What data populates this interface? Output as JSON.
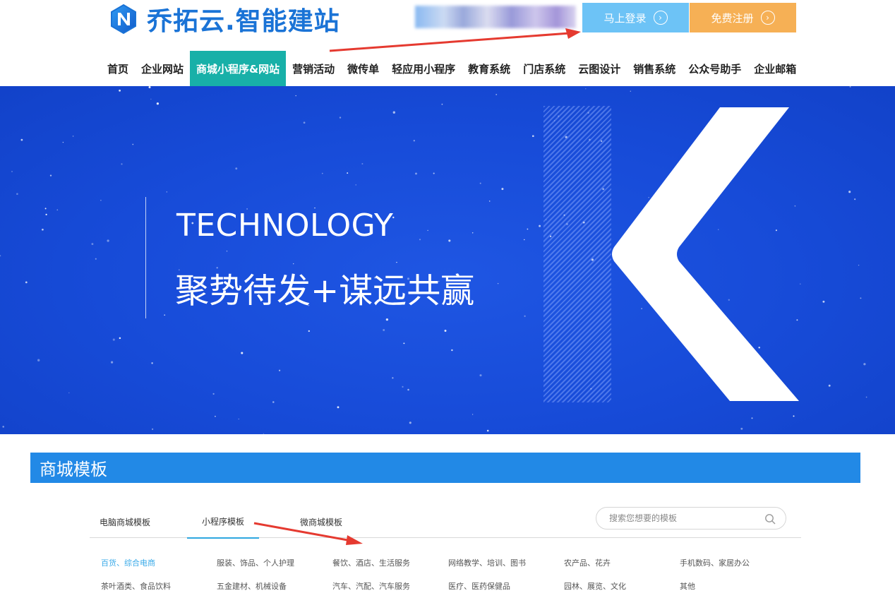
{
  "brand": {
    "logo_text": "乔拓云.智能建站",
    "logo_mark_icon": "n-logo-icon",
    "color": "#1a73d6"
  },
  "header": {
    "login_label": "马上登录",
    "register_label": "免费注册",
    "arrow_glyph": "›",
    "login_color": "#6dc3f6",
    "register_color": "#f6b055"
  },
  "nav": {
    "items": [
      {
        "label": "首页"
      },
      {
        "label": "企业网站"
      },
      {
        "label": "商城小程序&网站",
        "active": true
      },
      {
        "label": "营销活动"
      },
      {
        "label": "微传单"
      },
      {
        "label": "轻应用小程序"
      },
      {
        "label": "教育系统"
      },
      {
        "label": "门店系统"
      },
      {
        "label": "云图设计"
      },
      {
        "label": "销售系统"
      },
      {
        "label": "公众号助手"
      },
      {
        "label": "企业邮箱"
      }
    ],
    "active_color": "#18b0a8"
  },
  "banner": {
    "headline": "TECHNOLOGY",
    "slogan": "聚势待发+谋远共赢",
    "background": "#174bd8"
  },
  "section": {
    "title": "商城模板",
    "color": "#2289e6"
  },
  "tabs": {
    "items": [
      {
        "label": "电脑商城模板"
      },
      {
        "label": "小程序模板",
        "active": true
      },
      {
        "label": "微商城模板"
      }
    ],
    "search_placeholder": "搜索您想要的模板"
  },
  "categories": {
    "rows": [
      [
        "百货、综合电商",
        "服装、饰品、个人护理",
        "餐饮、酒店、生活服务",
        "网络教学、培训、图书",
        "农产品、花卉",
        "手机数码、家居办公"
      ],
      [
        "茶叶酒类、食品饮料",
        "五金建材、机械设备",
        "汽车、汽配、汽车服务",
        "医疗、医药保健品",
        "园林、展览、文化",
        "其他"
      ]
    ],
    "active_color": "#38a9e8"
  }
}
